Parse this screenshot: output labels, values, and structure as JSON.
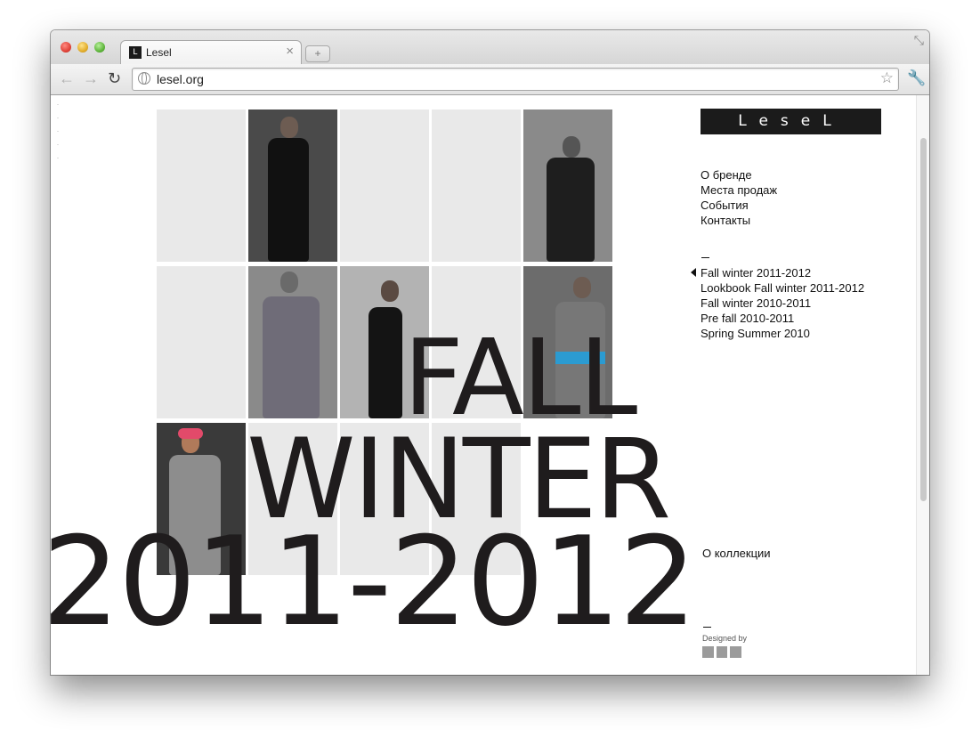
{
  "browser": {
    "tab_title": "Lesel",
    "favicon_glyph": "L",
    "url": "lesel.org",
    "tab_close_glyph": "×",
    "new_tab_glyph": "+",
    "back_glyph": "←",
    "forward_glyph": "→",
    "reload_glyph": "↻",
    "star_glyph": "☆",
    "wrench_glyph": "🔧",
    "fullscreen_glyph": "⤡"
  },
  "site": {
    "logo_text": "LeseL",
    "menu": [
      "О бренде",
      "Места продаж",
      "События",
      "Контакты"
    ],
    "collections": [
      "Fall winter 2011-2012",
      "Lookbook Fall winter 2011-2012",
      "Fall winter 2010-2011",
      "Pre fall 2010-2011",
      "Spring Summer 2010"
    ],
    "active_collection_index": 0,
    "headline_line1": "FALL",
    "headline_line2": "WINTER",
    "headline_line3": "2011-2012",
    "about_collection": "О коллекции",
    "designed_by": "Designed by"
  },
  "colors": {
    "text": "#1f1c1d",
    "tile_grey": "#e9e9e9",
    "logo_bg": "#1b1b1b"
  }
}
